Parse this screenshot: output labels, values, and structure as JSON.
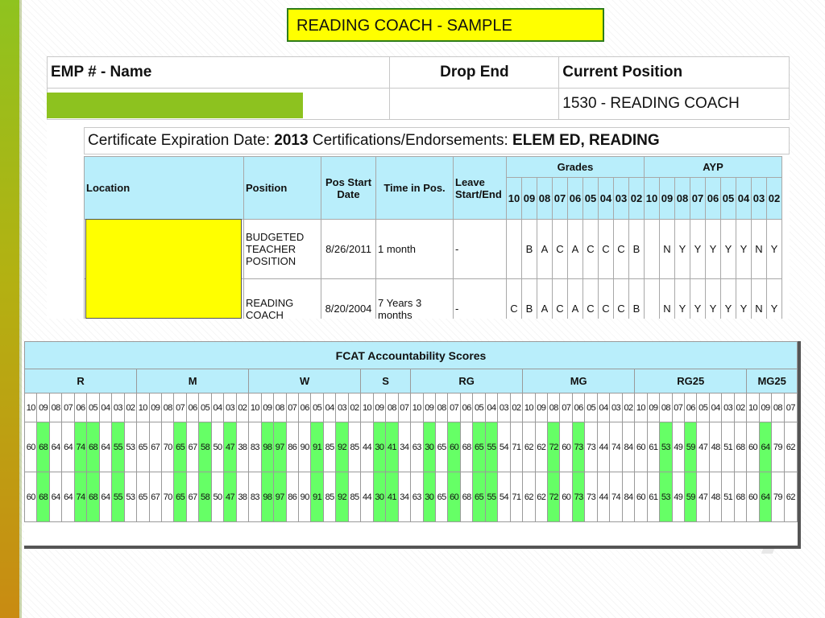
{
  "title": "READING COACH - SAMPLE",
  "employee": {
    "headers": [
      "EMP # - Name",
      "Drop End",
      "Current Position"
    ],
    "current_position": "1530 - READING COACH",
    "cert_label": "Certificate Expiration Date:",
    "cert_year": "2013",
    "cert_endorse_label": "Certifications/Endorsements:",
    "cert_endorse": "ELEM ED, READING"
  },
  "positions": {
    "headers": {
      "location": "Location",
      "position": "Position",
      "pos_start": "Pos Start Date",
      "time": "Time in Pos.",
      "leave": "Leave Start/End",
      "grades": "Grades",
      "ayp": "AYP"
    },
    "years": [
      "10",
      "09",
      "08",
      "07",
      "06",
      "05",
      "04",
      "03",
      "02"
    ],
    "rows": [
      {
        "position": "BUDGETED TEACHER POSITION",
        "start": "8/26/2011",
        "time": "1 month",
        "leave": "-",
        "grades": [
          "",
          "B",
          "A",
          "C",
          "A",
          "C",
          "C",
          "C",
          "B"
        ],
        "ayp": [
          "",
          "N",
          "Y",
          "Y",
          "Y",
          "Y",
          "Y",
          "N",
          "Y"
        ]
      },
      {
        "position": "READING COACH",
        "start": "8/20/2004",
        "time": "7 Years 3 months",
        "leave": "-",
        "grades": [
          "C",
          "B",
          "A",
          "C",
          "A",
          "C",
          "C",
          "C",
          "B"
        ],
        "ayp": [
          "",
          "N",
          "Y",
          "Y",
          "Y",
          "Y",
          "Y",
          "N",
          "Y"
        ]
      }
    ]
  },
  "fcat": {
    "title": "FCAT Accountability Scores",
    "groups": [
      {
        "name": "R",
        "years": [
          "10",
          "09",
          "08",
          "07",
          "06",
          "05",
          "04",
          "03",
          "02"
        ]
      },
      {
        "name": "M",
        "years": [
          "10",
          "09",
          "08",
          "07",
          "06",
          "05",
          "04",
          "03",
          "02"
        ]
      },
      {
        "name": "W",
        "years": [
          "10",
          "09",
          "08",
          "07",
          "06",
          "05",
          "04",
          "03",
          "02"
        ]
      },
      {
        "name": "S",
        "years": [
          "10",
          "09",
          "08",
          "07"
        ]
      },
      {
        "name": "RG",
        "years": [
          "10",
          "09",
          "08",
          "07",
          "06",
          "05",
          "04",
          "03",
          "02"
        ]
      },
      {
        "name": "MG",
        "years": [
          "10",
          "09",
          "08",
          "07",
          "06",
          "05",
          "04",
          "03",
          "02"
        ]
      },
      {
        "name": "RG25",
        "years": [
          "10",
          "09",
          "08",
          "07",
          "06",
          "05",
          "04",
          "03",
          "02"
        ]
      },
      {
        "name": "MG25",
        "years": [
          "10",
          "09",
          "08",
          "07"
        ]
      }
    ],
    "values": [
      "60",
      "68",
      "64",
      "64",
      "74",
      "68",
      "64",
      "55",
      "53",
      "65",
      "67",
      "70",
      "65",
      "67",
      "58",
      "50",
      "47",
      "38",
      "83",
      "98",
      "97",
      "86",
      "90",
      "91",
      "85",
      "92",
      "85",
      "44",
      "30",
      "41",
      "34",
      "63",
      "30",
      "65",
      "60",
      "68",
      "65",
      "55",
      "54",
      "71",
      "62",
      "62",
      "72",
      "60",
      "73",
      "73",
      "44",
      "74",
      "84",
      "60",
      "61",
      "53",
      "49",
      "59",
      "47",
      "48",
      "51",
      "68",
      "60",
      "64",
      "79",
      "62"
    ],
    "highlight": [
      1,
      4,
      5,
      7,
      12,
      14,
      16,
      19,
      20,
      23,
      25,
      28,
      29,
      32,
      34,
      36,
      37,
      42,
      44,
      51,
      53,
      59
    ],
    "rows": 2
  }
}
